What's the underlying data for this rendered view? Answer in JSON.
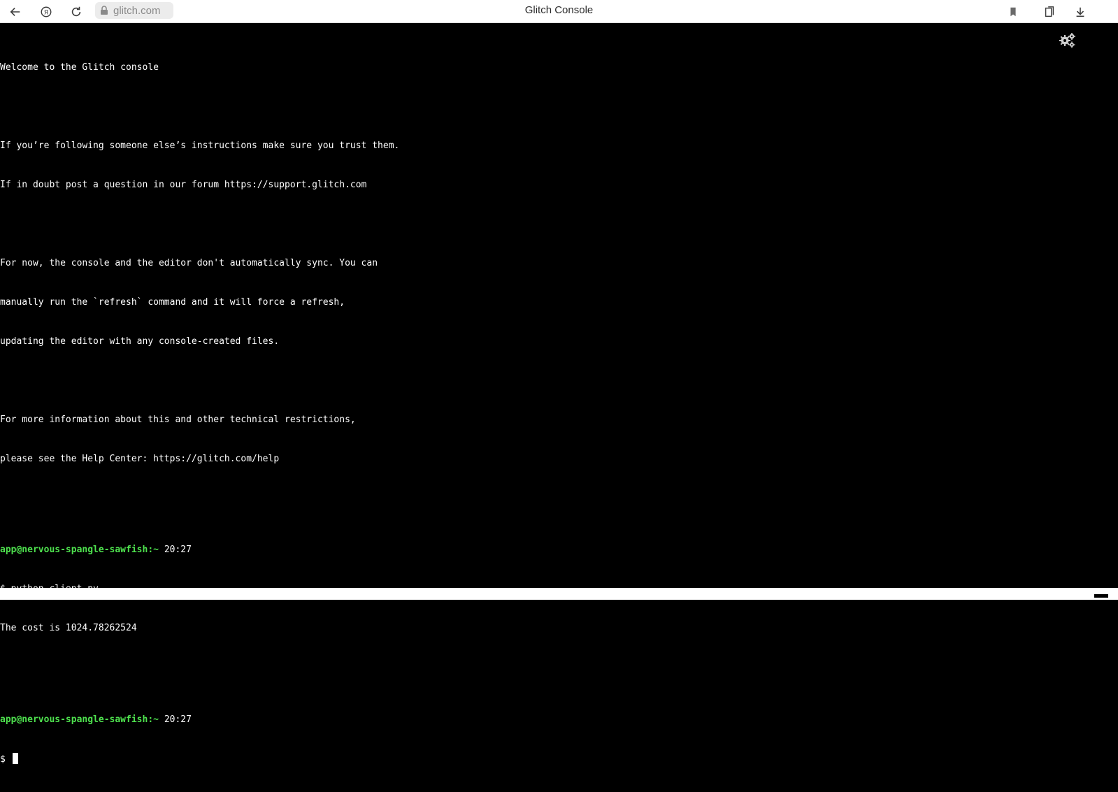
{
  "browser": {
    "url": "glitch.com",
    "title": "Glitch Console",
    "icons": [
      "back-arrow-icon",
      "yandex-icon",
      "reload-icon",
      "lock-icon",
      "bookmark-icon",
      "collections-icon",
      "download-icon"
    ]
  },
  "terminal": {
    "settings_icon": "gears-icon",
    "lines": [
      {
        "text": "Welcome to the Glitch console"
      },
      {
        "text": ""
      },
      {
        "text": "If you’re following someone else’s instructions make sure you trust them."
      },
      {
        "text": "If in doubt post a question in our forum https://support.glitch.com"
      },
      {
        "text": ""
      },
      {
        "text": "For now, the console and the editor don't automatically sync. You can"
      },
      {
        "text": "manually run the `refresh` command and it will force a refresh,"
      },
      {
        "text": "updating the editor with any console-created files."
      },
      {
        "text": ""
      },
      {
        "text": "For more information about this and other technical restrictions,"
      },
      {
        "text": "please see the Help Center: https://glitch.com/help"
      },
      {
        "text": ""
      }
    ],
    "session": [
      {
        "user": "app@nervous-spangle-sawfish:",
        "dir": "~",
        "time": "20:27",
        "command": "$ python client.py",
        "output": "The cost is 1024.78262524"
      },
      {
        "user": "app@nervous-spangle-sawfish:",
        "dir": "~",
        "time": "20:27",
        "command": "$ ",
        "output": null
      }
    ],
    "colors": {
      "prompt": "#4ee24e",
      "text": "#ffffff",
      "background": "#000000"
    }
  }
}
